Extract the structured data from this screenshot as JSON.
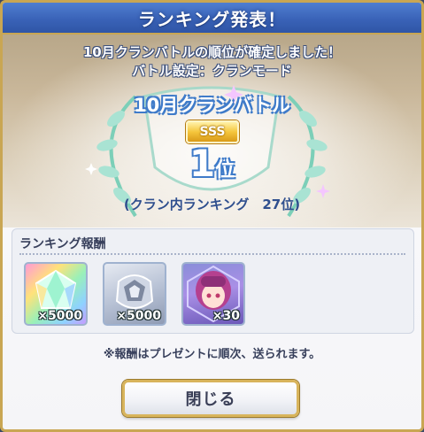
{
  "dialog": {
    "title": "ランキング発表！",
    "message_line1": "10月クランバトルの順位が確定しました！",
    "message_line2": "バトル設定：クランモード",
    "battle_name": "10月クランバトル",
    "grade": "SSS",
    "rank_number": "1",
    "rank_unit": "位",
    "clan_ranking": "(クラン内ランキング　27位)"
  },
  "rewards": {
    "title": "ランキング報酬",
    "items": [
      {
        "name": "rainbow-crystal-icon",
        "quantity": "×5000"
      },
      {
        "name": "silver-ore-icon",
        "quantity": "×5000"
      },
      {
        "name": "character-portrait-icon",
        "quantity": "×30"
      }
    ]
  },
  "notice": "※報酬はプレゼントに順次、送られます。",
  "close_label": "閉じる",
  "colors": {
    "title_bar": "#3a63b8",
    "frame_gold": "#c9a653",
    "rank_outline": "#3f7bc9"
  }
}
